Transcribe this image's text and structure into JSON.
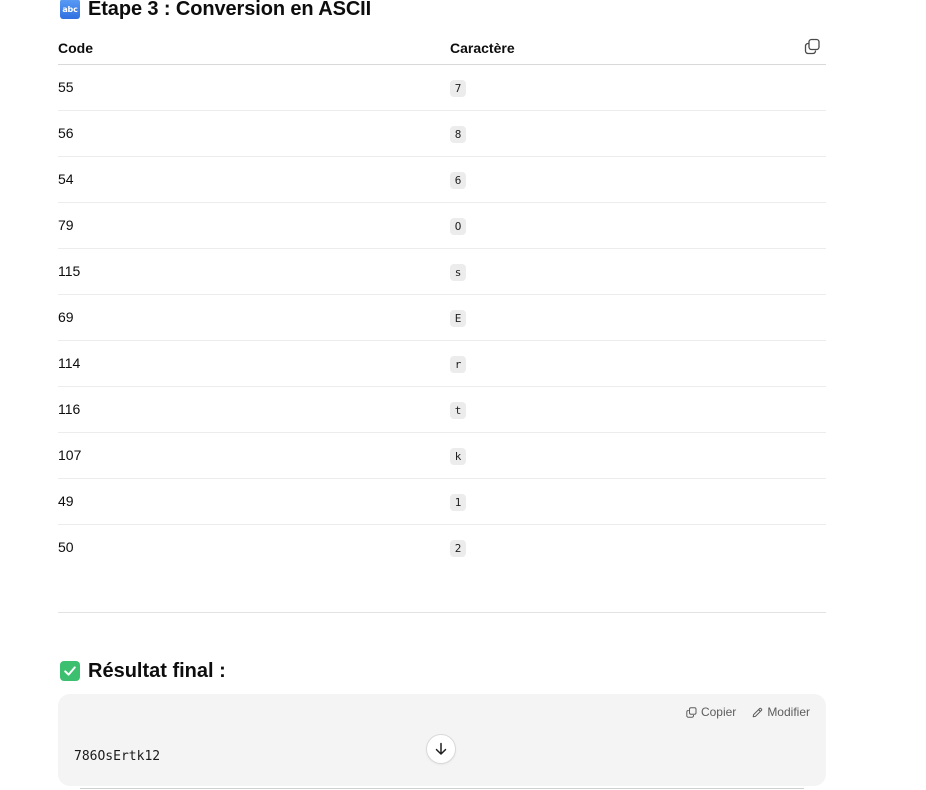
{
  "step3": {
    "emoji": "abc",
    "title": "Etape 3 : Conversion en ASCII"
  },
  "table": {
    "headers": [
      "Code",
      "Caractère"
    ],
    "rows": [
      {
        "code": "55",
        "char": "7"
      },
      {
        "code": "56",
        "char": "8"
      },
      {
        "code": "54",
        "char": "6"
      },
      {
        "code": "79",
        "char": "O"
      },
      {
        "code": "115",
        "char": "s"
      },
      {
        "code": "69",
        "char": "E"
      },
      {
        "code": "114",
        "char": "r"
      },
      {
        "code": "116",
        "char": "t"
      },
      {
        "code": "107",
        "char": "k"
      },
      {
        "code": "49",
        "char": "1"
      },
      {
        "code": "50",
        "char": "2"
      }
    ],
    "copy_icon": "copy-icon"
  },
  "final": {
    "title": "Résultat final :",
    "emoji": "check-mark-button-icon"
  },
  "code_block": {
    "copy_label": "Copier",
    "edit_label": "Modifier",
    "content": "786OsErtk12"
  },
  "colors": {
    "check_green": "#3cc06f",
    "abc_blue": "#2f6fe0",
    "code_bg": "#f4f4f4"
  }
}
